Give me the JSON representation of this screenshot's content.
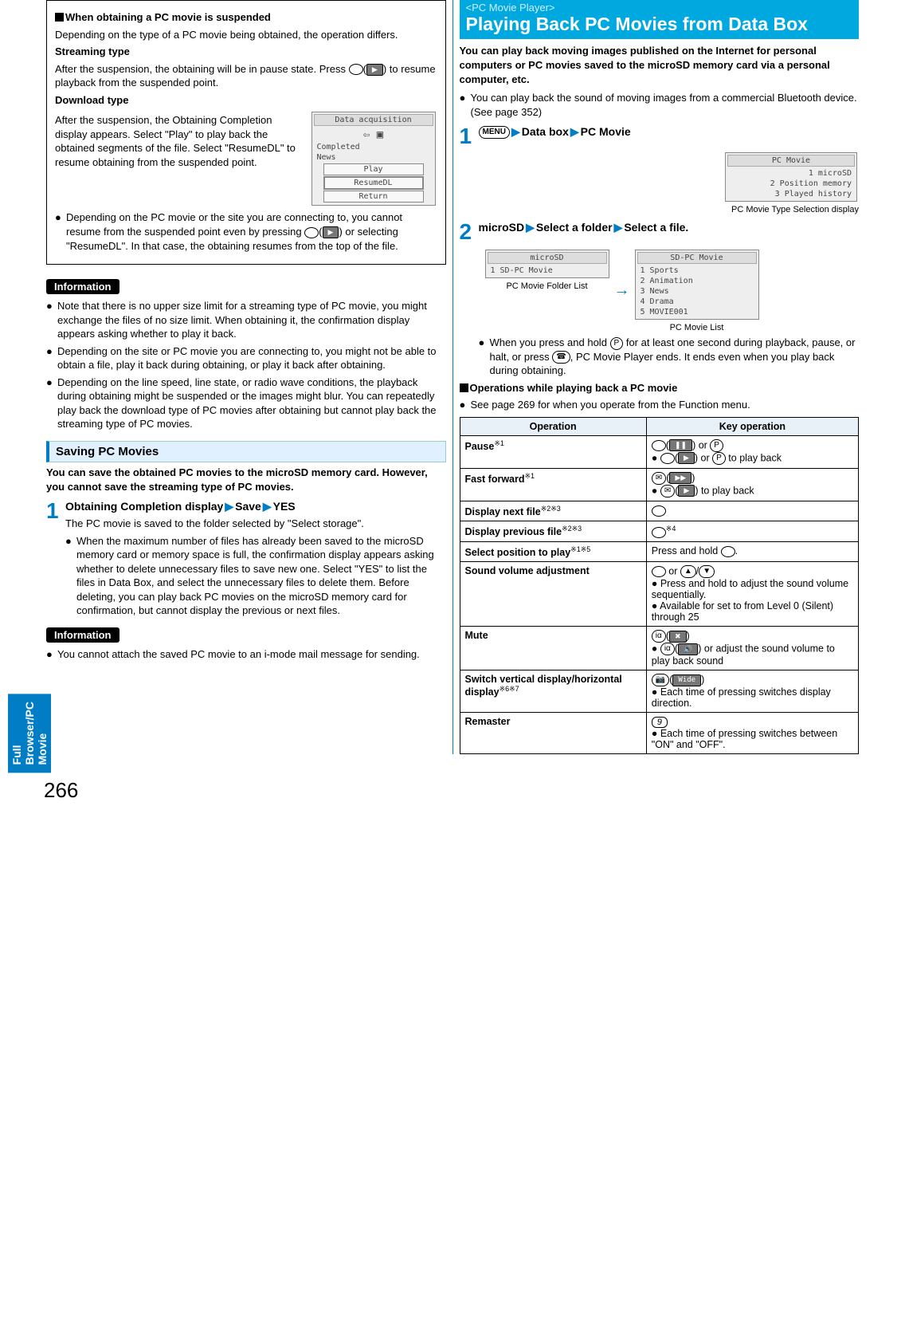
{
  "sideTab": "Full Browser/PC Movie",
  "pageNumber": "266",
  "left": {
    "box1": {
      "title": "When obtaining a PC movie is suspended",
      "p1": "Depending on the type of a PC movie being obtained, the operation differs.",
      "h1": "Streaming type",
      "p2_a": "After the suspension, the obtaining will be in pause state. Press ",
      "p2_b": " to resume playback from the suspended point.",
      "h2": "Download type",
      "p3": "After the suspension, the Obtaining Completion display appears. Select \"Play\" to play back the obtained segments of the file. Select \"ResumeDL\" to resume obtaining from the suspended point.",
      "bul1_a": "Depending on the PC movie or the site you are connecting to, you cannot resume from the suspended point even by pressing ",
      "bul1_b": " or selecting \"ResumeDL\". In that case, the obtaining resumes from the top of the file.",
      "screen": {
        "title": "Data acquisition",
        "line1": "Completed",
        "line2": "News",
        "btn1": "Play",
        "btn2": "ResumeDL",
        "btn3": "Return"
      }
    },
    "info1": {
      "label": "Information",
      "b1": "Note that there is no upper size limit for a streaming type of PC movie, you might exchange the files of no size limit. When obtaining it, the confirmation display appears asking whether to play it back.",
      "b2": "Depending on the site or PC movie you are connecting to, you might not be able to obtain a file, play it back during obtaining, or play it back after obtaining.",
      "b3": "Depending on the line speed, line state, or radio wave conditions, the playback during obtaining might be suspended or the images might blur. You can repeatedly play back the download type of PC movies after obtaining but cannot play back the streaming type of PC movies."
    },
    "saving": {
      "heading": "Saving PC Movies",
      "lead": "You can save the obtained PC movies to the microSD memory card. However, you cannot save the streaming type of PC movies.",
      "step1_title_a": "Obtaining Completion display",
      "step1_title_b": "Save",
      "step1_title_c": "YES",
      "step1_p": "The PC movie is saved to the folder selected by \"Select storage\".",
      "step1_b1": "When the maximum number of files has already been saved to the microSD memory card or memory space is full, the confirmation display appears asking whether to delete unnecessary files to save new one. Select \"YES\" to list the files in Data Box, and select the unnecessary files to delete them. Before deleting, you can play back PC movies on the microSD memory card for confirmation, but cannot display the previous or next files."
    },
    "info2": {
      "label": "Information",
      "b1": "You cannot attach the saved PC movie to an i-mode mail message for sending."
    }
  },
  "right": {
    "header_sup": "<PC Movie Player>",
    "header_main": "Playing Back PC Movies from Data Box",
    "lead": "You can play back moving images published on the Internet for personal computers or PC movies saved to the microSD memory card via a personal computer, etc.",
    "b1": "You can play back the sound of moving images from a commercial Bluetooth device. (See page 352)",
    "step1_a": "Data box",
    "step1_b": "PC Movie",
    "step2": "microSD",
    "step2_b": "Select a folder",
    "step2_c": "Select a file.",
    "caption1": "PC Movie Type Selection display",
    "caption2a": "PC Movie Folder List",
    "caption2b": "PC Movie List",
    "screenA": {
      "title": "PC Movie",
      "r1": "1 microSD",
      "r2": "2 Position memory",
      "r3": "3 Played history"
    },
    "screenB": {
      "title": "microSD",
      "r1": "1 SD-PC Movie"
    },
    "screenC": {
      "title": "SD-PC Movie",
      "r1": "1 Sports",
      "r2": "2 Animation",
      "r3": "3 News",
      "r4": "4 Drama",
      "r5": "5 MOVIE001"
    },
    "note_a": "When you press and hold ",
    "note_b": " for at least one second during playback, pause, or halt, or press ",
    "note_c": ", PC Movie Player ends. It ends even when you play back during obtaining.",
    "ops_title": "Operations while playing back a PC movie",
    "ops_note": "See page 269 for when you operate from the Function menu.",
    "table": {
      "h1": "Operation",
      "h2": "Key operation",
      "r1c1": "Pause",
      "r1s": "※1",
      "r1c2b": " to play back",
      "r2c1": "Fast forward",
      "r2s": "※1",
      "r2c2b": " to play back",
      "r3c1": "Display next file",
      "r3s": "※2※3",
      "r4c1": "Display previous file",
      "r4s": "※2※3",
      "r4c2s": "※4",
      "r5c1": "Select position to play",
      "r5s": "※1※5",
      "r5c2": "Press and hold ",
      "r6c1": "Sound volume adjustment",
      "r6c2a": "Press and hold to adjust the sound volume sequentially.",
      "r6c2b": "Available for set to from Level 0 (Silent) through 25",
      "r7c1": "Mute",
      "r7c2": " or adjust the sound volume to play back sound",
      "r8c1": "Switch vertical display/horizontal display",
      "r8s": "※6※7",
      "r8c2": "Each time of pressing switches display direction.",
      "r8btn": "Wide",
      "r9c1": "Remaster",
      "r9c2": "Each time of pressing switches between \"ON\" and \"OFF\"."
    }
  }
}
